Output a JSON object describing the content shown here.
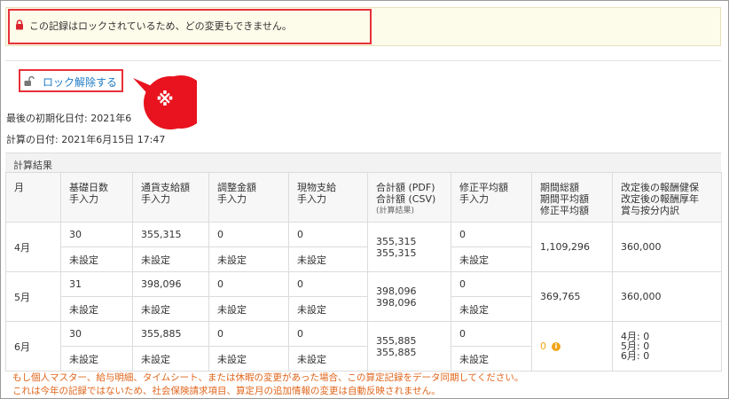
{
  "lock_banner": {
    "message": "この記録はロックされているため、どの変更もできません。"
  },
  "unlock": {
    "label": "ロック解除する"
  },
  "callout": {
    "text": "※"
  },
  "meta": {
    "initialized": "最後の初期化日付: 2021年6",
    "calculated": "計算の日付: 2021年6月15日 17:47"
  },
  "section": {
    "title": "計算結果"
  },
  "table": {
    "headers": {
      "month": "月",
      "base_days": [
        "基礎日数",
        "手入力"
      ],
      "currency": [
        "通貨支給額",
        "手入力"
      ],
      "adjust": [
        "調整金額",
        "手入力"
      ],
      "in_kind": [
        "現物支給",
        "手入力"
      ],
      "total": [
        "合計額 (PDF)",
        "合計額 (CSV)"
      ],
      "total_sub": "(計算結果)",
      "mod_avg": [
        "修正平均額",
        "手入力"
      ],
      "period": [
        "期間総額",
        "期間平均額",
        "修正平均額"
      ],
      "revised": [
        "改定後の報酬健保",
        "改定後の報酬厚年",
        "賞与按分内訳"
      ]
    },
    "rows": [
      {
        "month": "4月",
        "base_days": "30",
        "currency": "355,315",
        "adjust": "0",
        "in_kind": "0",
        "total_a": "355,315",
        "total_b": "355,315",
        "mod_avg": "0",
        "period": "1,109,296",
        "revised": "360,000",
        "base_days2": "未設定",
        "currency2": "未設定",
        "adjust2": "未設定",
        "in_kind2": "未設定",
        "mod_avg2": "未設定"
      },
      {
        "month": "5月",
        "base_days": "31",
        "currency": "398,096",
        "adjust": "0",
        "in_kind": "0",
        "total_a": "398,096",
        "total_b": "398,096",
        "mod_avg": "0",
        "period": "369,765",
        "revised": "360,000",
        "base_days2": "未設定",
        "currency2": "未設定",
        "adjust2": "未設定",
        "in_kind2": "未設定",
        "mod_avg2": "未設定"
      },
      {
        "month": "6月",
        "base_days": "30",
        "currency": "355,885",
        "adjust": "0",
        "in_kind": "0",
        "total_a": "355,885",
        "total_b": "355,885",
        "mod_avg": "0",
        "period": "0",
        "revised_lines": [
          "4月: 0",
          "5月: 0",
          "6月: 0"
        ],
        "base_days2": "未設定",
        "currency2": "未設定",
        "adjust2": "未設定",
        "in_kind2": "未設定",
        "mod_avg2": "未設定"
      }
    ]
  },
  "notes": [
    "もし個人マスター、給与明細、タイムシート、または休暇の変更があった場合、この算定記録をデータ同期してください。",
    "これは今年の記録ではないため、社会保険請求項目、算定月の追加情報の変更は自動反映されません。"
  ],
  "colors": {
    "link": "#1e7bc4",
    "highlight": "#e8313a",
    "warning": "#e0651b",
    "banner_bg": "#fdfbea"
  }
}
